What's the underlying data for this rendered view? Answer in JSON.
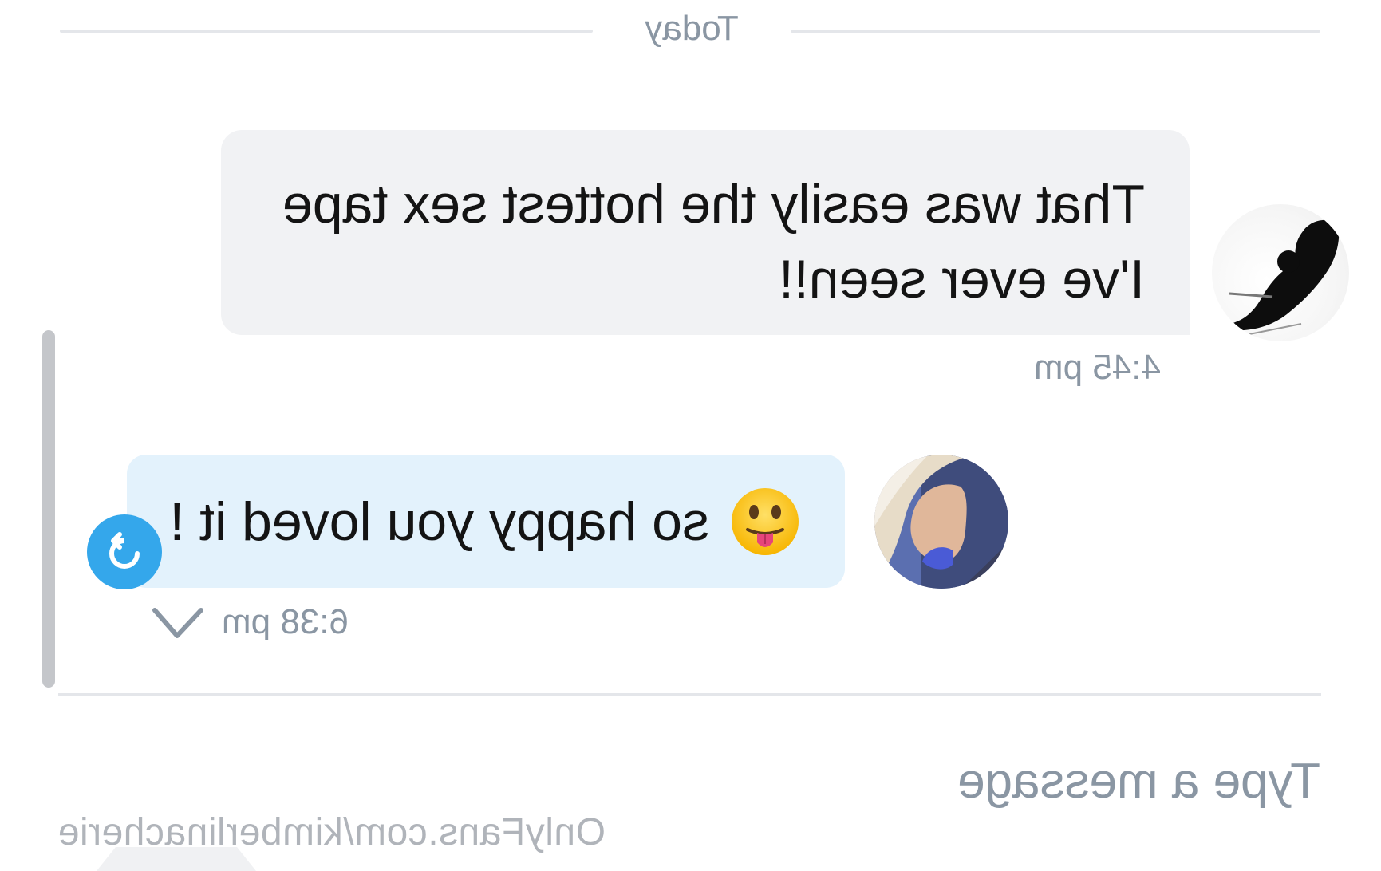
{
  "date_divider": {
    "label": "Today"
  },
  "messages": [
    {
      "direction": "incoming",
      "text": "That was easily the hottest sex tape I've ever seen!!",
      "time": "4:45 pm"
    },
    {
      "direction": "outgoing",
      "text": "so happy you loved it !",
      "emoji": "face-with-tongue",
      "time": "6:38 pm",
      "status_icon": "chevron-check-icon",
      "action_icon": "retry-arrow-icon"
    }
  ],
  "composer": {
    "placeholder": "Type a message"
  },
  "watermark": {
    "text": "OnlyFans.com/kimberlinacherie"
  },
  "colors": {
    "incoming_bubble": "#f1f2f4",
    "outgoing_bubble": "#e3f2fc",
    "accent": "#34a7eb",
    "muted_text": "#8a96a3"
  }
}
